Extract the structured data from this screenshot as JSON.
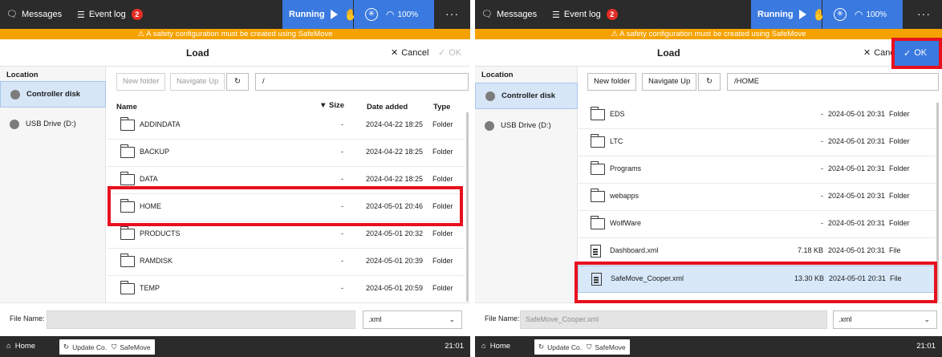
{
  "topbar": {
    "messages_label": "Messages",
    "eventlog_label": "Event log",
    "eventlog_count": "2",
    "running_label": "Running",
    "speed_label": "100%",
    "more_label": "···"
  },
  "warning": "⚠  A safety configuration must be created using SafeMove",
  "dialog": {
    "title": "Load",
    "cancel_label": "Cancel",
    "ok_label": "OK"
  },
  "sidebar": {
    "heading": "Location",
    "items": [
      {
        "label": "Controller disk"
      },
      {
        "label": "USB Drive (D:)"
      }
    ]
  },
  "toolbar": {
    "new_folder_label": "New folder",
    "navigate_up_label": "Navigate Up",
    "refresh_icon": "↻"
  },
  "columns": {
    "name": "Name",
    "size": "Size",
    "date": "Date added",
    "type": "Type"
  },
  "left": {
    "path": "/",
    "rows": [
      {
        "name": "ADDINDATA",
        "size": "-",
        "date": "2024-04-22 18:25",
        "type": "Folder",
        "icon": "folder-icon"
      },
      {
        "name": "BACKUP",
        "size": "-",
        "date": "2024-04-22 18:25",
        "type": "Folder",
        "icon": "folder-icon"
      },
      {
        "name": "DATA",
        "size": "-",
        "date": "2024-04-22 18:25",
        "type": "Folder",
        "icon": "folder-icon"
      },
      {
        "name": "HOME",
        "size": "-",
        "date": "2024-05-01 20:46",
        "type": "Folder",
        "icon": "folder-icon"
      },
      {
        "name": "PRODUCTS",
        "size": "-",
        "date": "2024-05-01 20:32",
        "type": "Folder",
        "icon": "folder-icon"
      },
      {
        "name": "RAMDISK",
        "size": "-",
        "date": "2024-05-01 20:39",
        "type": "Folder",
        "icon": "folder-icon"
      },
      {
        "name": "TEMP",
        "size": "-",
        "date": "2024-05-01 20:59",
        "type": "Folder",
        "icon": "folder-icon"
      }
    ],
    "filename_label": "File Name:",
    "filename_value": "",
    "ext_value": ".xml"
  },
  "right": {
    "path": "/HOME",
    "rows": [
      {
        "name": "EDS",
        "size": "-",
        "date": "2024-05-01 20:31",
        "type": "Folder",
        "icon": "folder-icon"
      },
      {
        "name": "LTC",
        "size": "-",
        "date": "2024-05-01 20:31",
        "type": "Folder",
        "icon": "folder-icon"
      },
      {
        "name": "Programs",
        "size": "-",
        "date": "2024-05-01 20:31",
        "type": "Folder",
        "icon": "folder-icon"
      },
      {
        "name": "webapps",
        "size": "-",
        "date": "2024-05-01 20:31",
        "type": "Folder",
        "icon": "folder-icon"
      },
      {
        "name": "WolfWare",
        "size": "-",
        "date": "2024-05-01 20:31",
        "type": "Folder",
        "icon": "folder-icon"
      },
      {
        "name": "Dashboard.xml",
        "size": "7.18 KB",
        "date": "2024-05-01 20:31",
        "type": "File",
        "icon": "file-icon"
      },
      {
        "name": "SafeMove_Cooper.xml",
        "size": "13.30 KB",
        "date": "2024-05-01 20:31",
        "type": "File",
        "icon": "file-icon"
      }
    ],
    "filename_label": "File Name:",
    "filename_value": "SafeMove_Cooper.xml",
    "ext_value": ".xml"
  },
  "taskbar": {
    "home_label": "Home",
    "update_label": "Update Co...",
    "safemove_label": "SafeMove",
    "clock": "21:01"
  },
  "colors": {
    "accent": "#3a7ae0",
    "warning": "#f5a200",
    "highlight": "#e8101e",
    "topbar": "#2b2b2b"
  }
}
